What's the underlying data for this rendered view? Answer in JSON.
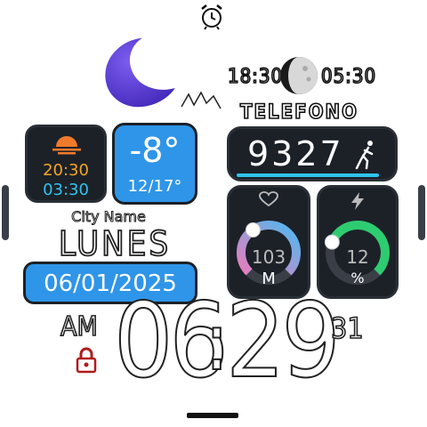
{
  "alarm": {
    "icon": "alarm-clock-icon"
  },
  "weather": {
    "icon": "crescent-moon-icon",
    "moon_color": "#5a3fd6"
  },
  "sun_tile": {
    "icon": "sunrise-icon",
    "sunset_time": "20:30",
    "sunrise_time": "03:30"
  },
  "temp_tile": {
    "current": "-8°",
    "range": "12/17°"
  },
  "city": "City Name",
  "day_name": "LUNES",
  "date": "06/01/2025",
  "moon_phase": {
    "left_time": "18:30",
    "right_time": "05:30",
    "icon": "moon-phase-icon"
  },
  "phone_label": "TELEFONO",
  "steps": {
    "value": "9327",
    "icon": "walking-icon",
    "progress": 0.93
  },
  "heart": {
    "icon": "heart-icon",
    "value": "103",
    "unit": "M",
    "progress": 0.6
  },
  "battery": {
    "icon": "lightning-icon",
    "value": "12",
    "unit": "%",
    "progress": 0.6
  },
  "time": {
    "ampm": "AM",
    "hours": "06",
    "minutes": "29",
    "seconds": "31",
    "lock_icon": "lock-icon"
  },
  "colors": {
    "accent_blue": "#2f95e8",
    "sunset_orange": "#f5a623",
    "sunrise_cyan": "#2fc4f0",
    "heart_pink": "#e87dbd",
    "battery_green": "#2ecc71"
  }
}
